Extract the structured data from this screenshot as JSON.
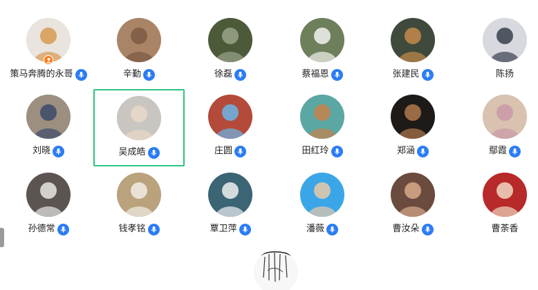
{
  "participants": [
    {
      "name": "策马奔腾的永哥",
      "mic": true,
      "host": true,
      "selected": false,
      "bg": "#e9e4dd",
      "fg": "#d89a52"
    },
    {
      "name": "辛勤",
      "mic": true,
      "host": false,
      "selected": false,
      "bg": "#a98466",
      "fg": "#7b5a43"
    },
    {
      "name": "徐磊",
      "mic": true,
      "host": false,
      "selected": false,
      "bg": "#4d5a3a",
      "fg": "#9aa38a"
    },
    {
      "name": "蔡福恩",
      "mic": true,
      "host": false,
      "selected": false,
      "bg": "#6e7f5c",
      "fg": "#f2f2ee"
    },
    {
      "name": "张建民",
      "mic": true,
      "host": false,
      "selected": false,
      "bg": "#3f4a3c",
      "fg": "#c58a4a"
    },
    {
      "name": "陈扬",
      "mic": false,
      "host": false,
      "selected": false,
      "bg": "#d7d9df",
      "fg": "#3a3e4e"
    },
    {
      "name": "刘晓",
      "mic": true,
      "host": false,
      "selected": false,
      "bg": "#9c8f80",
      "fg": "#3c4a6a"
    },
    {
      "name": "吴成皓",
      "mic": true,
      "host": false,
      "selected": true,
      "bg": "#c9c6c2",
      "fg": "#e9d9c8"
    },
    {
      "name": "庄圆",
      "mic": true,
      "host": false,
      "selected": false,
      "bg": "#b44a3a",
      "fg": "#6bb6e8"
    },
    {
      "name": "田红玲",
      "mic": true,
      "host": false,
      "selected": false,
      "bg": "#5aa7a4",
      "fg": "#c8824a"
    },
    {
      "name": "郑涵",
      "mic": true,
      "host": false,
      "selected": false,
      "bg": "#1e1a18",
      "fg": "#b07a4e"
    },
    {
      "name": "鄢霞",
      "mic": true,
      "host": false,
      "selected": false,
      "bg": "#d9c2b0",
      "fg": "#c99aa8"
    },
    {
      "name": "孙德常",
      "mic": true,
      "host": false,
      "selected": false,
      "bg": "#5c5451",
      "fg": "#e8e6e4"
    },
    {
      "name": "钱孝铭",
      "mic": true,
      "host": false,
      "selected": false,
      "bg": "#b9a27c",
      "fg": "#f1ede4"
    },
    {
      "name": "覃卫萍",
      "mic": true,
      "host": false,
      "selected": false,
      "bg": "#3b6475",
      "fg": "#f0f0f0"
    },
    {
      "name": "潘薇",
      "mic": true,
      "host": false,
      "selected": false,
      "bg": "#3aa6e8",
      "fg": "#e9c9a8"
    },
    {
      "name": "曹汝朵",
      "mic": true,
      "host": false,
      "selected": false,
      "bg": "#6a4b3e",
      "fg": "#d9a98a"
    },
    {
      "name": "曹荼香",
      "mic": false,
      "host": false,
      "selected": false,
      "bg": "#b8292a",
      "fg": "#f0d7c2"
    }
  ],
  "colors": {
    "mic": "#2b7cf6",
    "selected_border": "#2ec27e",
    "host_badge": "#ff7a1a"
  },
  "icons": {
    "mic": "microphone-icon",
    "host": "host-user-icon"
  }
}
